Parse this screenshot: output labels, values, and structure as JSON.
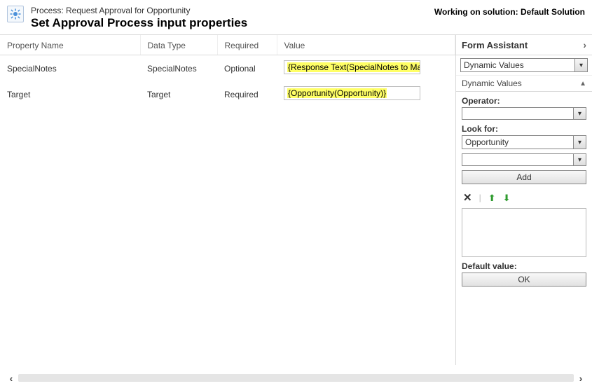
{
  "header": {
    "process_label": "Process: Request Approval for Opportunity",
    "page_title": "Set Approval Process input properties",
    "solution": "Working on solution: Default Solution"
  },
  "grid": {
    "columns": {
      "name": "Property Name",
      "data_type": "Data Type",
      "required": "Required",
      "value": "Value"
    },
    "rows": [
      {
        "name": "SpecialNotes",
        "data_type": "SpecialNotes",
        "required": "Optional",
        "value": "{Response Text(SpecialNotes to Manager)}"
      },
      {
        "name": "Target",
        "data_type": "Target",
        "required": "Required",
        "value": "{Opportunity(Opportunity)}"
      }
    ]
  },
  "assistant": {
    "title": "Form Assistant",
    "top_select": "Dynamic Values",
    "section": "Dynamic Values",
    "operator_label": "Operator:",
    "operator_value": "",
    "lookfor_label": "Look for:",
    "lookfor_value": "Opportunity",
    "lookfor_field": "",
    "add_label": "Add",
    "default_label": "Default value:",
    "ok_label": "OK"
  }
}
